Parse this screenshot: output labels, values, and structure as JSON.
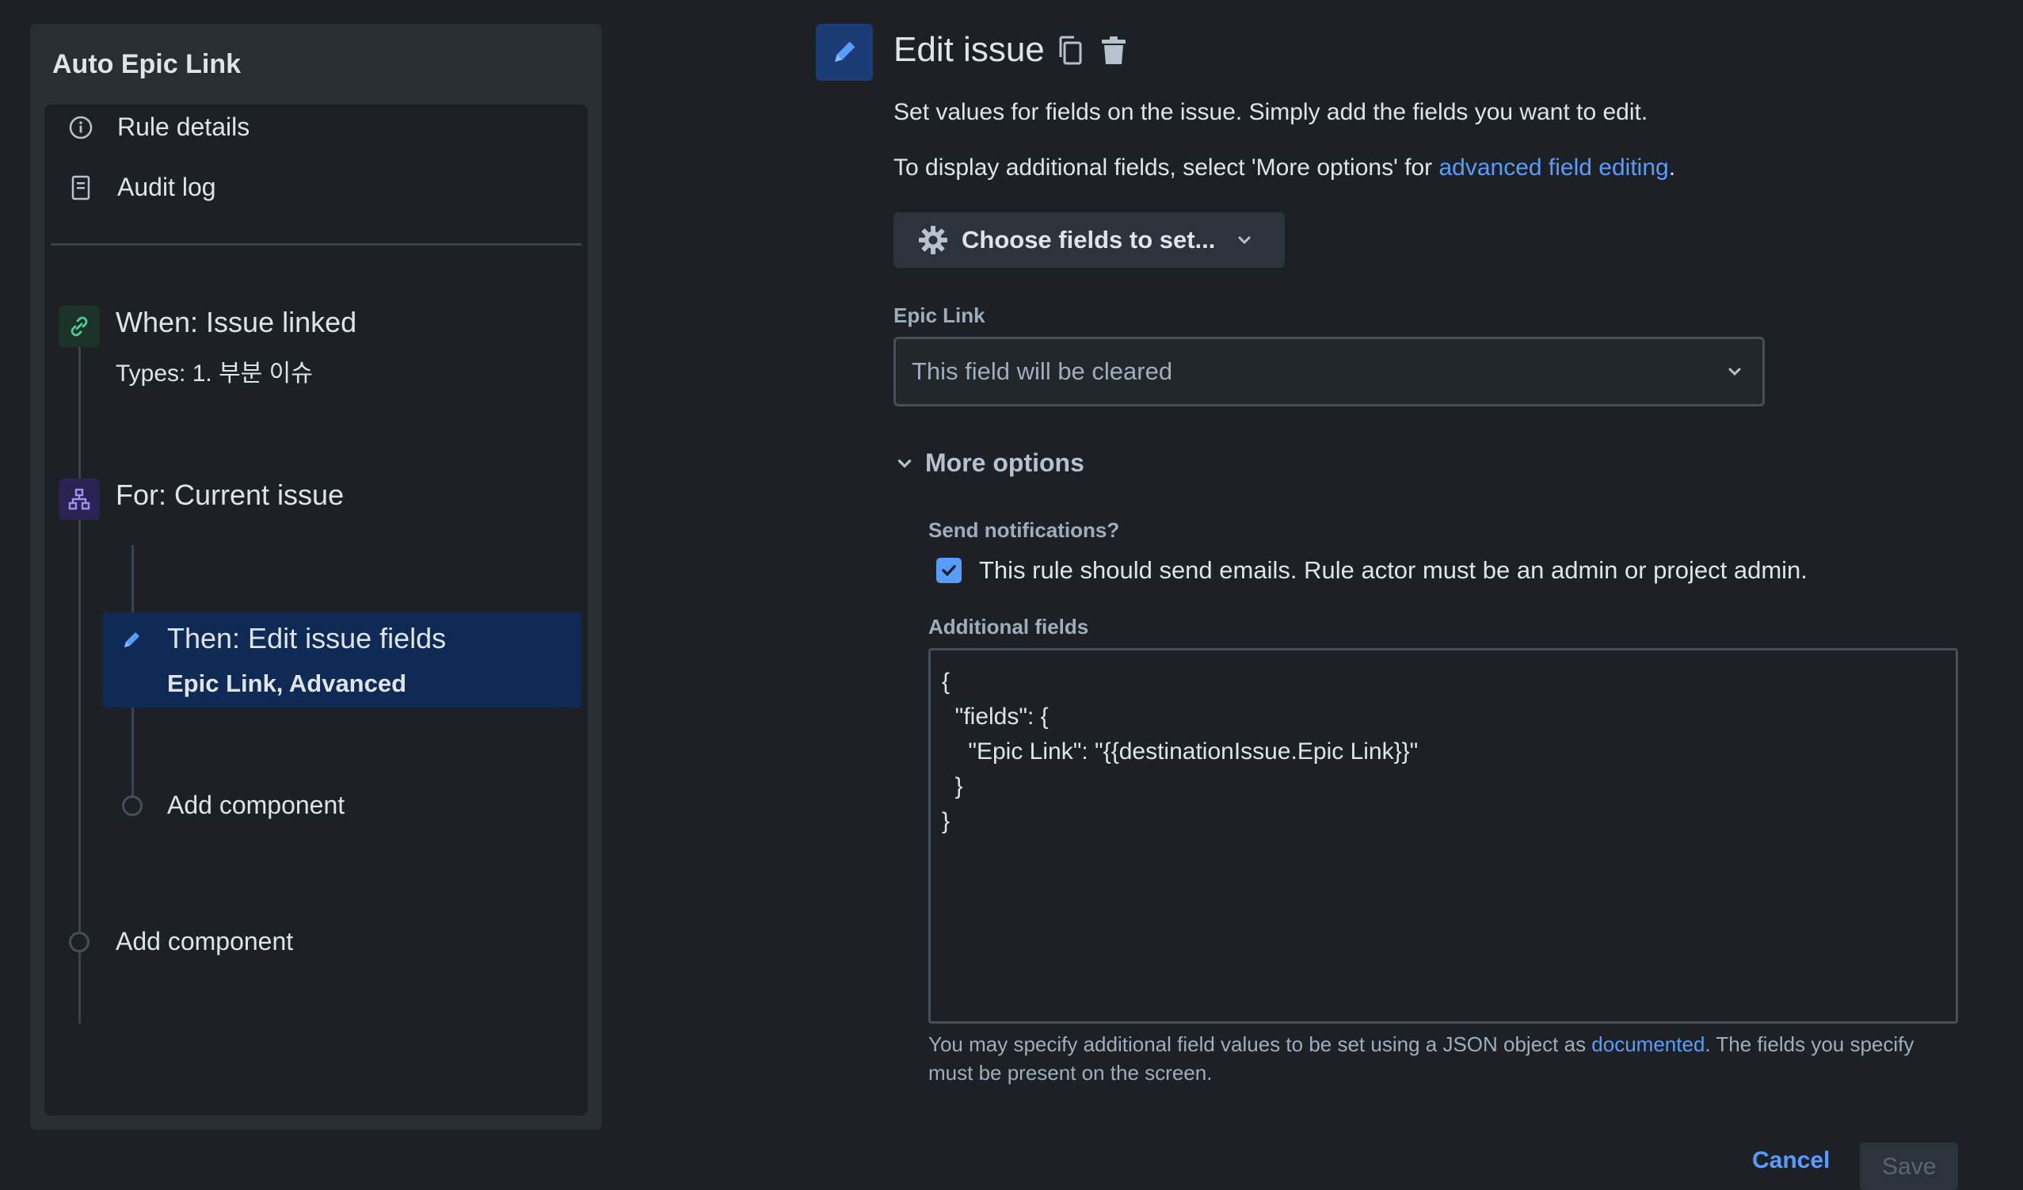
{
  "sidebar": {
    "rule_name": "Auto Epic Link",
    "nav": [
      {
        "label": "Rule details",
        "icon": "info-icon"
      },
      {
        "label": "Audit log",
        "icon": "document-icon"
      }
    ],
    "components": {
      "trigger": {
        "title": "When: Issue linked",
        "subtitle": "Types: 1. 부분 이슈",
        "icon": "link-icon"
      },
      "branch": {
        "title": "For: Current issue",
        "icon": "branch-icon"
      },
      "action": {
        "title": "Then: Edit issue fields",
        "subtitle": "Epic Link, Advanced",
        "icon": "pencil-icon"
      },
      "add_component_inner": "Add component",
      "add_component_outer": "Add component"
    }
  },
  "editor": {
    "title": "Edit issue",
    "description": "Set values for fields on the issue. Simply add the fields you want to edit.",
    "additional_info_prefix": "To display additional fields, select 'More options' for ",
    "additional_info_link": "advanced field editing",
    "additional_info_suffix": ".",
    "choose_fields_label": "Choose fields to set...",
    "epic_link_label": "Epic Link",
    "epic_link_value": "This field will be cleared",
    "more_options_label": "More options",
    "send_notifications_label": "Send notifications?",
    "send_notifications_checked": true,
    "send_notifications_text": "This rule should send emails. Rule actor must be an admin or project admin.",
    "additional_fields_label": "Additional fields",
    "additional_fields_json": "{\n  \"fields\": {\n    \"Epic Link\": \"{{destinationIssue.Epic Link}}\"\n  }\n}",
    "help_prefix": "You may specify additional field values to be set using a JSON object as ",
    "help_link": "documented",
    "help_suffix": ". The fields you specify must be present on the screen.",
    "cancel_label": "Cancel",
    "save_label": "Save"
  },
  "colors": {
    "background": "#1d2125",
    "panel": "#282e33",
    "selected": "#0f2a55",
    "link": "#579dff",
    "trigger_icon_bg": "#1c3329",
    "branch_icon_bg": "#2b2452"
  }
}
